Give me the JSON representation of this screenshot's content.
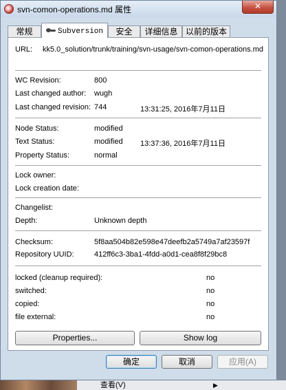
{
  "window": {
    "title": "svn-comon-operations.md 属性",
    "close_label": "✕"
  },
  "tabs": [
    {
      "label": "常规"
    },
    {
      "label": "Subversion"
    },
    {
      "label": "安全"
    },
    {
      "label": "详细信息"
    },
    {
      "label": "以前的版本"
    }
  ],
  "url": {
    "label": "URL:",
    "value": "kk5.0_solution/trunk/training/svn-usage/svn-comon-operations.md"
  },
  "revision": {
    "wc_label": "WC Revision:",
    "wc_value": "800",
    "author_label": "Last changed author:",
    "author_value": "wugh",
    "rev_label": "Last changed revision:",
    "rev_value": "744",
    "rev_date": "13:31:25, 2016年7月11日"
  },
  "status": {
    "node_label": "Node Status:",
    "node_value": "modified",
    "text_label": "Text Status:",
    "text_value": "modified",
    "text_date": "13:37:36, 2016年7月11日",
    "prop_label": "Property Status:",
    "prop_value": "normal"
  },
  "lock": {
    "owner_label": "Lock owner:",
    "date_label": "Lock creation date:"
  },
  "changelist": {
    "label": "Changelist:",
    "depth_label": "Depth:",
    "depth_value": "Unknown depth"
  },
  "checksum": {
    "label": "Checksum:",
    "value": "5f8aa504b82e598e47deefb2a5749a7af23597f",
    "uuid_label": "Repository UUID:",
    "uuid_value": "412ff6c3-3ba1-4fdd-a0d1-cea8f8f29bc8"
  },
  "flags": [
    {
      "label": "locked (cleanup required):",
      "value": "no"
    },
    {
      "label": "switched:",
      "value": "no"
    },
    {
      "label": "copied:",
      "value": "no"
    },
    {
      "label": "file external:",
      "value": "no"
    }
  ],
  "panel_buttons": {
    "properties": "Properties...",
    "show_log": "Show log"
  },
  "dialog_buttons": {
    "ok": "确定",
    "cancel": "取消",
    "apply": "应用(A)"
  },
  "taskbar": {
    "menu_text": "查看(V)",
    "arrow": "▶"
  }
}
